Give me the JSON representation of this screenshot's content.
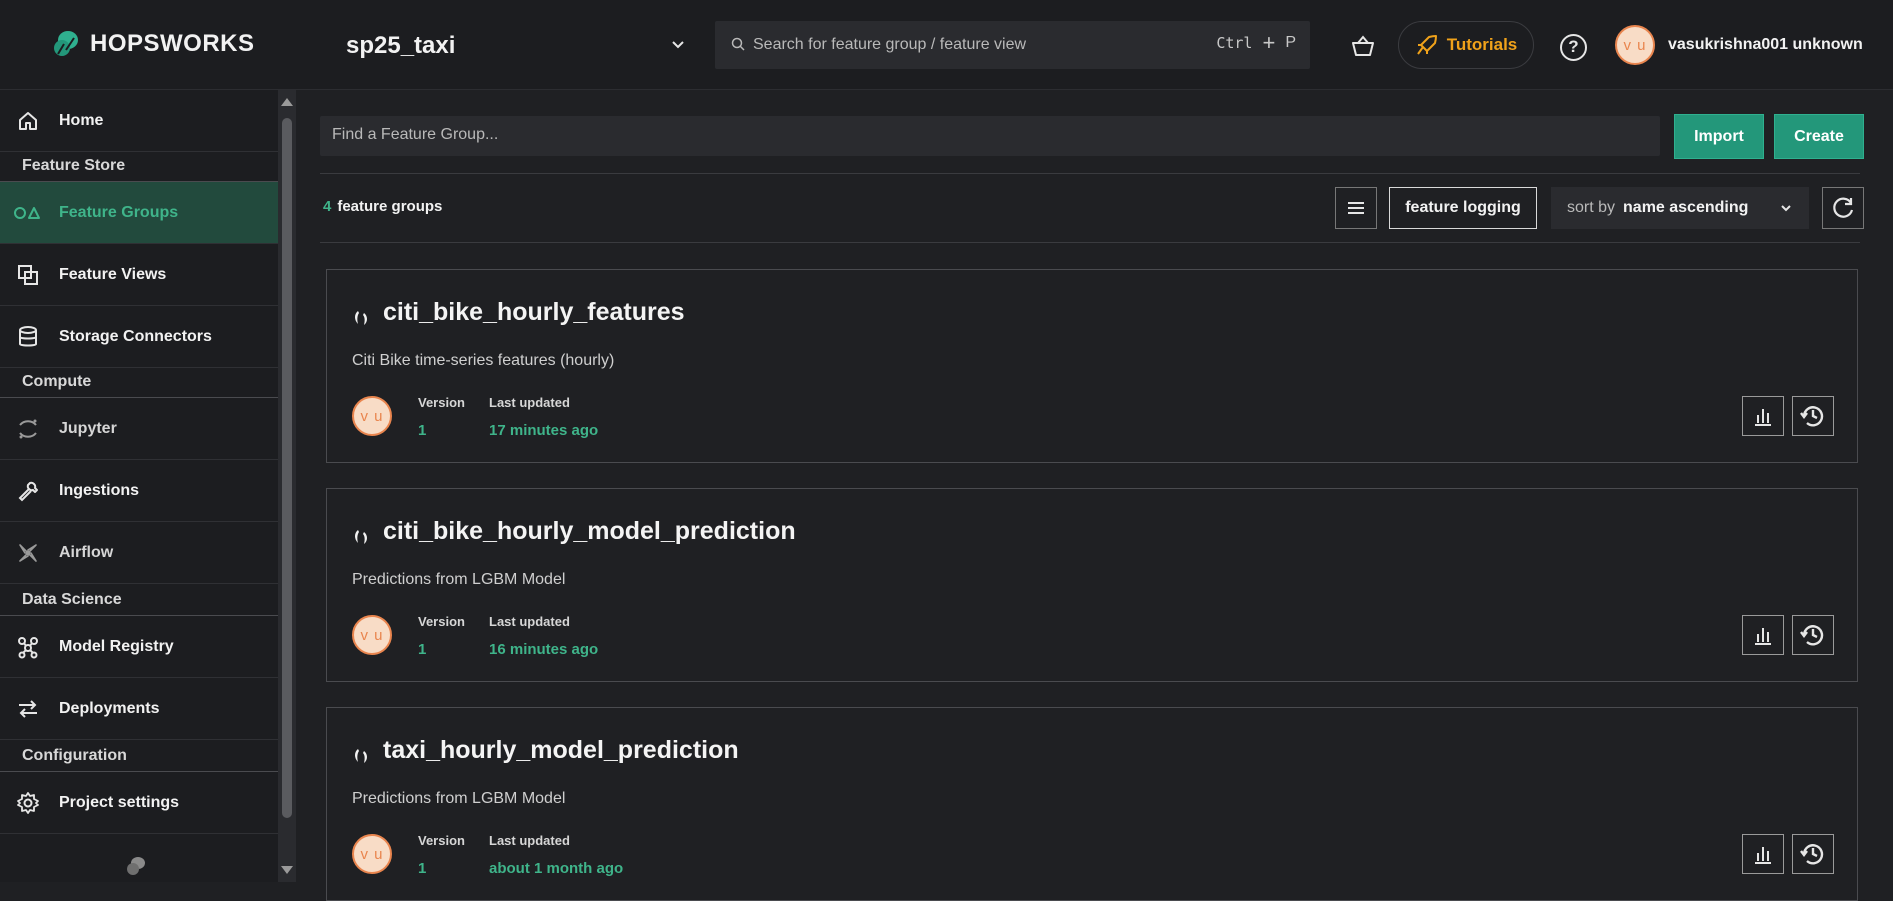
{
  "header": {
    "brand": "HOPSWORKS",
    "project": "sp25_taxi",
    "search_placeholder": "Search for feature group / feature view",
    "shortcut_ctrl": "Ctrl",
    "shortcut_plus": "+",
    "shortcut_key": "P",
    "tutorials_label": "Tutorials",
    "help_label": "?",
    "avatar_initials": "v u",
    "user_name": "vasukrishna001 unknown"
  },
  "sidebar": {
    "home": "Home",
    "section_feature_store": "Feature Store",
    "feature_groups": "Feature Groups",
    "feature_views": "Feature Views",
    "storage_connectors": "Storage Connectors",
    "section_compute": "Compute",
    "jupyter": "Jupyter",
    "ingestions": "Ingestions",
    "airflow": "Airflow",
    "section_data_science": "Data Science",
    "model_registry": "Model Registry",
    "deployments": "Deployments",
    "section_configuration": "Configuration",
    "project_settings": "Project settings"
  },
  "main": {
    "find_placeholder": "Find a Feature Group...",
    "import_label": "Import",
    "create_label": "Create",
    "count": "4",
    "count_label": "feature groups",
    "feature_logging_label": "feature logging",
    "sort_label": "sort by",
    "sort_value": "name ascending",
    "version_header": "Version",
    "updated_header": "Last updated",
    "feature_groups": [
      {
        "name": "citi_bike_hourly_features",
        "description": "Citi Bike time-series features (hourly)",
        "avatar": "v u",
        "version": "1",
        "updated": "17 minutes ago"
      },
      {
        "name": "citi_bike_hourly_model_prediction",
        "description": "Predictions from LGBM Model",
        "avatar": "v u",
        "version": "1",
        "updated": "16 minutes ago"
      },
      {
        "name": "taxi_hourly_model_prediction",
        "description": "Predictions from LGBM Model",
        "avatar": "v u",
        "version": "1",
        "updated": "about 1 month ago"
      }
    ]
  },
  "colors": {
    "accent": "#3fb48a",
    "button_green": "#23977a",
    "tutorials_orange": "#f0a21a",
    "avatar_orange": "#e9854e",
    "background": "#1f2023"
  }
}
